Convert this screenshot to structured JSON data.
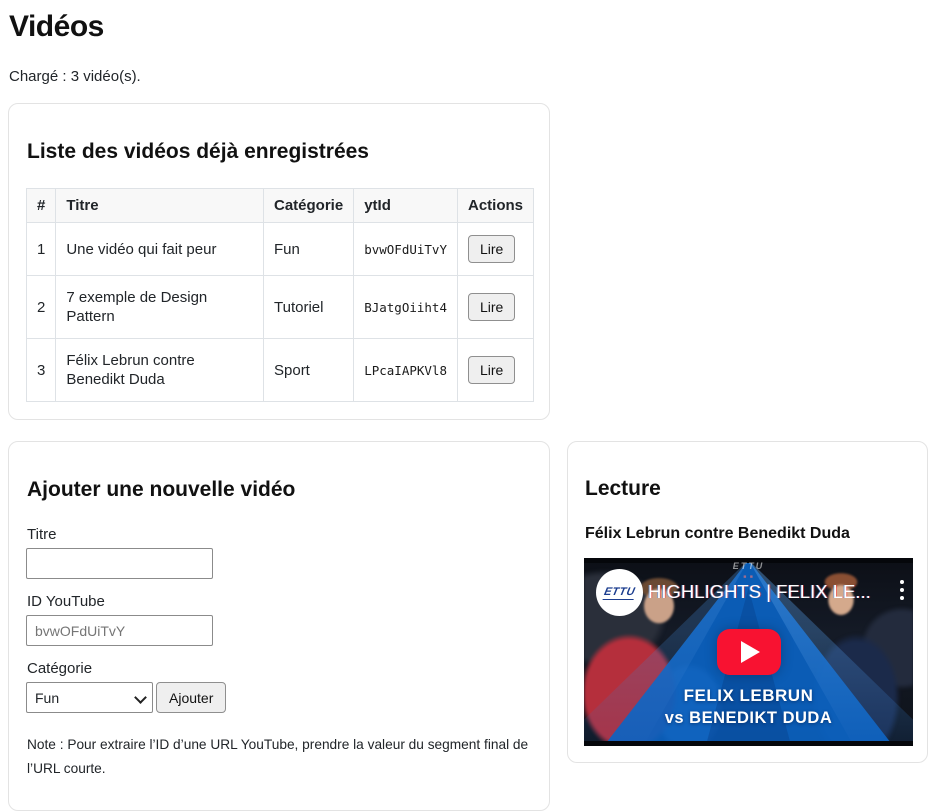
{
  "page": {
    "title": "Vidéos",
    "status": "Chargé : 3 vidéo(s)."
  },
  "list_card": {
    "heading": "Liste des vidéos déjà enregistrées",
    "table": {
      "headers": [
        "#",
        "Titre",
        "Catégorie",
        "ytId",
        "Actions"
      ],
      "rows": [
        {
          "num": "1",
          "titre": "Une vidéo qui fait peur",
          "categorie": "Fun",
          "ytid": "bvwOFdUiTvY",
          "action": "Lire"
        },
        {
          "num": "2",
          "titre": "7 exemple de Design Pattern",
          "categorie": "Tutoriel",
          "ytid": "BJatgOiiht4",
          "action": "Lire"
        },
        {
          "num": "3",
          "titre": "Félix Lebrun contre Benedikt Duda",
          "categorie": "Sport",
          "ytid": "LPcaIAPKVl8",
          "action": "Lire"
        }
      ]
    }
  },
  "add_card": {
    "heading": "Ajouter une nouvelle vidéo",
    "titre_label": "Titre",
    "titre_value": "",
    "ytid_label": "ID YouTube",
    "ytid_placeholder": "bvwOFdUiTvY",
    "categorie_label": "Catégorie",
    "categorie_selected": "Fun",
    "submit_label": "Ajouter",
    "note": "Note : Pour extraire l’ID d’une URL YouTube, prendre la valeur du segment final de l’URL courte."
  },
  "player_card": {
    "heading": "Lecture",
    "video_title": "Félix Lebrun contre Benedikt Duda",
    "thumbnail": {
      "overlay_title": "HIGHLIGHTS | FELIX LE...",
      "logo_text": "ETTU",
      "watermark_text": "ETTU",
      "caption_line1": "FELIX LEBRUN",
      "caption_line2": "vs BENEDIKT DUDA",
      "colors": {
        "accent_blue": "#0b62c1",
        "play_red": "#f81231"
      }
    }
  }
}
